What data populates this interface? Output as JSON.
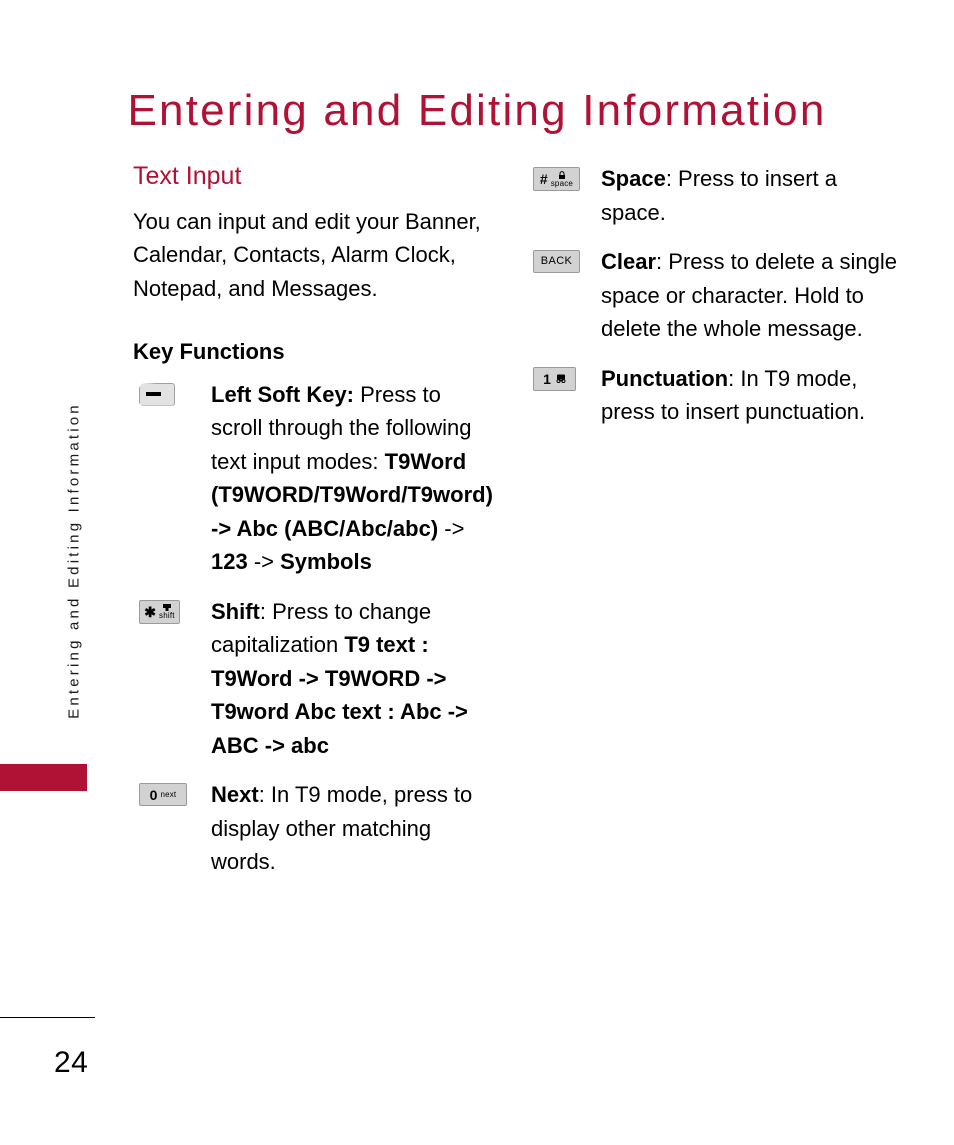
{
  "page": {
    "title": "Entering and Editing Information",
    "side_tab_text": "Entering and Editing Information",
    "page_number": "24",
    "accent_color": "#B01236",
    "text_color": "#000000"
  },
  "left_column": {
    "section_heading": "Text Input",
    "intro_paragraph": "You can input and edit your Banner, Calendar, Contacts, Alarm Clock, Notepad, and Messages.",
    "sub_heading": "Key Functions",
    "entries": [
      {
        "icon": "left-soft-key-icon",
        "icon_glyph": "—",
        "title": "Left Soft Key:",
        "body_normal_1": "Press to scroll through the following text input modes: ",
        "body_bold_1": "T9Word (T9WORD/T9Word/T9word) -> Abc (ABC/Abc/abc)",
        "body_normal_2": " -> ",
        "body_bold_2": "123",
        "body_normal_3": " -> ",
        "body_bold_3": "Symbols"
      },
      {
        "icon": "star-shift-key-icon",
        "icon_big": "✱",
        "icon_small": "shift",
        "title": "Shift",
        "body_normal_1": ": Press to change capitalization",
        "body_bold_1": "T9 text : T9Word -> T9WORD -> T9word Abc text : Abc -> ABC -> abc"
      },
      {
        "icon": "zero-next-key-icon",
        "icon_big": "0",
        "icon_small": "next",
        "title": "Next",
        "body_normal_1": ": In T9 mode, press to display other matching words."
      }
    ]
  },
  "right_column": {
    "entries": [
      {
        "icon": "hash-space-key-icon",
        "icon_big": "#",
        "icon_small": "space",
        "icon_extra": "lock-icon",
        "title": "Space",
        "body_normal_1": ": Press to insert a space."
      },
      {
        "icon": "back-key-icon",
        "icon_label": "BACK",
        "title": "Clear",
        "body_normal_1": ": Press to delete a single space or character. Hold to delete the whole message."
      },
      {
        "icon": "one-punctuation-key-icon",
        "icon_big": "1",
        "icon_extra": "voicemail-icon",
        "title": "Punctuation",
        "body_normal_1": ": In T9 mode, press to insert punctuation."
      }
    ]
  }
}
